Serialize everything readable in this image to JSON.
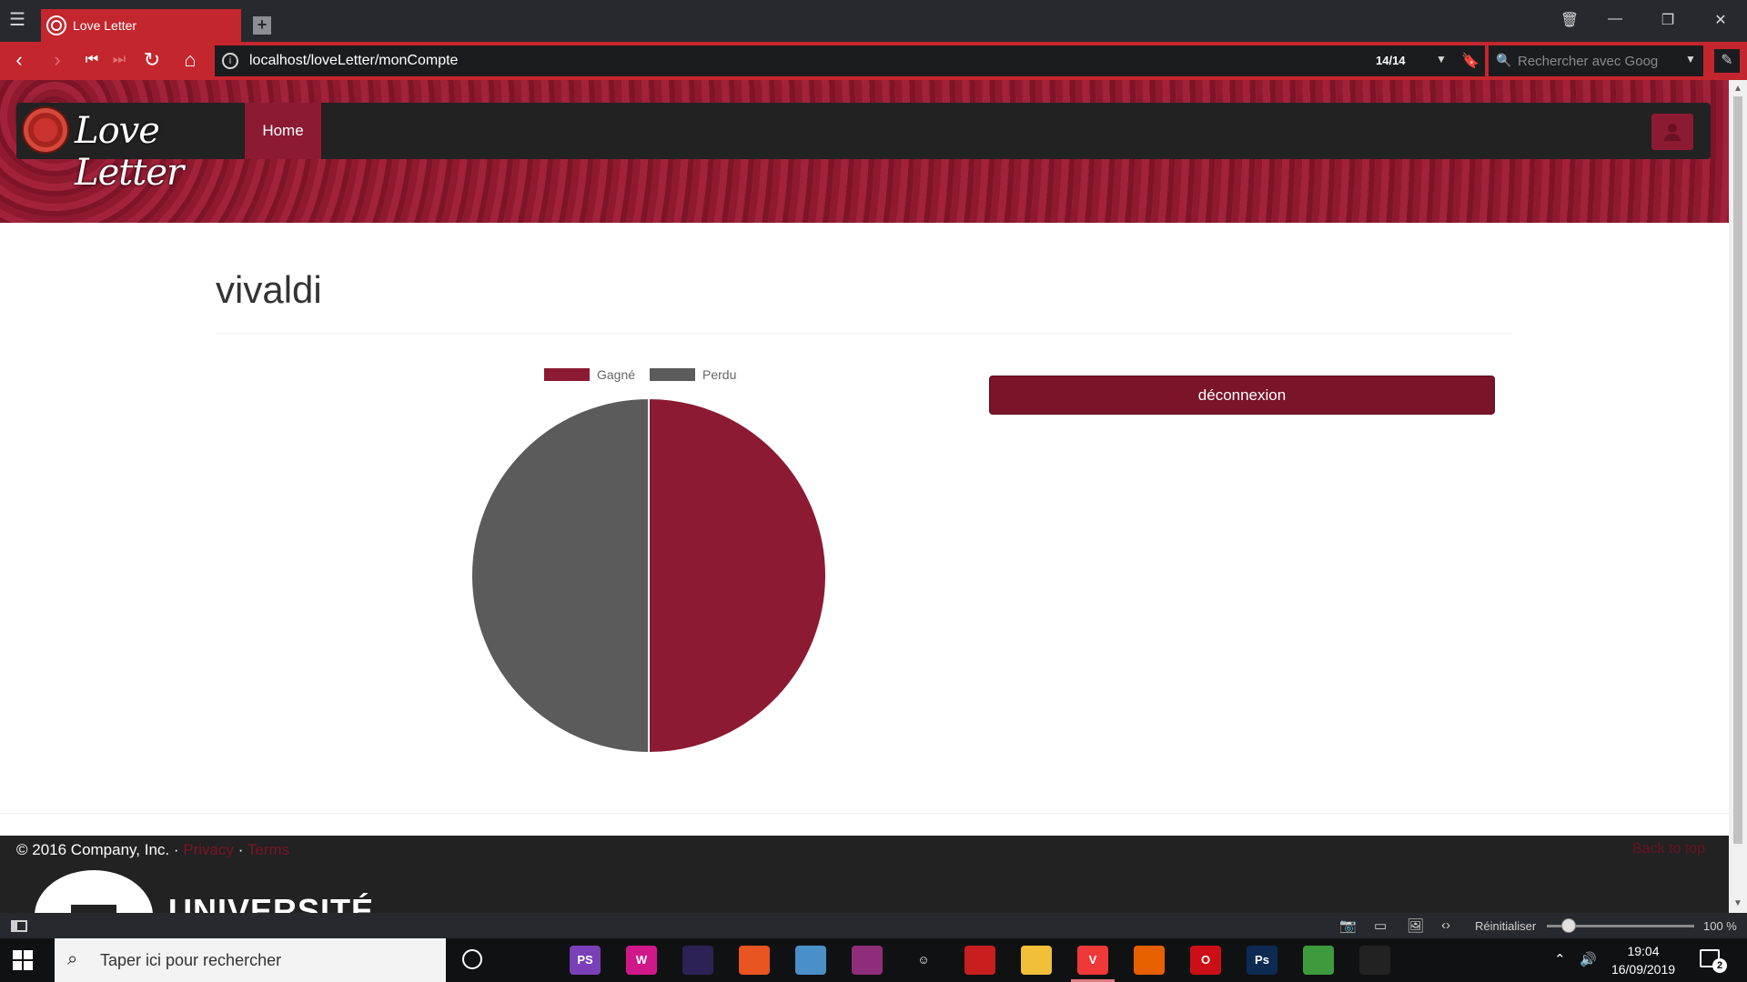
{
  "browser": {
    "tab_title": "Love Letter",
    "url": "localhost/loveLetter/monCompte",
    "page_counter": "14/14",
    "search_placeholder": "Rechercher avec Goog"
  },
  "site": {
    "brand": "Love Letter",
    "nav_home": "Home"
  },
  "profile": {
    "username": "vivaldi",
    "logout_label": "déconnexion"
  },
  "chart_data": {
    "type": "pie",
    "labels": [
      "Gagné",
      "Perdu"
    ],
    "values": [
      50,
      50
    ],
    "colors": [
      "#8c1a33",
      "#5b5b5b"
    ],
    "legend": "top"
  },
  "footer": {
    "copyright": "© 2016 Company, Inc. ·",
    "privacy": "Privacy",
    "dot": "·",
    "terms": "Terms",
    "back_to_top": "Back to top",
    "university": "UNIVERSITÉ"
  },
  "statusbar": {
    "reset_label": "Réinitialiser",
    "zoom_label": "100 %",
    "zoom_level": 0.15
  },
  "taskbar": {
    "search_placeholder": "Taper ici pour rechercher",
    "time": "19:04",
    "date": "16/09/2019",
    "notif_count": "2",
    "apps": [
      {
        "name": "phpstorm-icon",
        "label": "PS",
        "bg": "#7b3fb8"
      },
      {
        "name": "wamp-icon",
        "label": "W",
        "bg": "#d1188a"
      },
      {
        "name": "eclipse-icon",
        "label": "",
        "bg": "#2c2255"
      },
      {
        "name": "ubuntu-icon",
        "label": "",
        "bg": "#e95420"
      },
      {
        "name": "paint-icon",
        "label": "",
        "bg": "#4a90c8"
      },
      {
        "name": "winrar-icon",
        "label": "",
        "bg": "#8e2e7a"
      },
      {
        "name": "smiley-icon",
        "label": "☺",
        "bg": "#101113"
      },
      {
        "name": "acrobat-icon",
        "label": "",
        "bg": "#c81e1e"
      },
      {
        "name": "explorer-icon",
        "label": "",
        "bg": "#f2c038"
      },
      {
        "name": "vivaldi-icon",
        "label": "V",
        "bg": "#ef3939",
        "active": true
      },
      {
        "name": "firefox-icon",
        "label": "",
        "bg": "#e66000"
      },
      {
        "name": "opera-icon",
        "label": "O",
        "bg": "#cc0f16"
      },
      {
        "name": "photoshop-icon",
        "label": "Ps",
        "bg": "#0c2a52"
      },
      {
        "name": "git-icon",
        "label": "",
        "bg": "#3d9a3d"
      },
      {
        "name": "photos-icon",
        "label": "",
        "bg": "#222"
      }
    ]
  }
}
